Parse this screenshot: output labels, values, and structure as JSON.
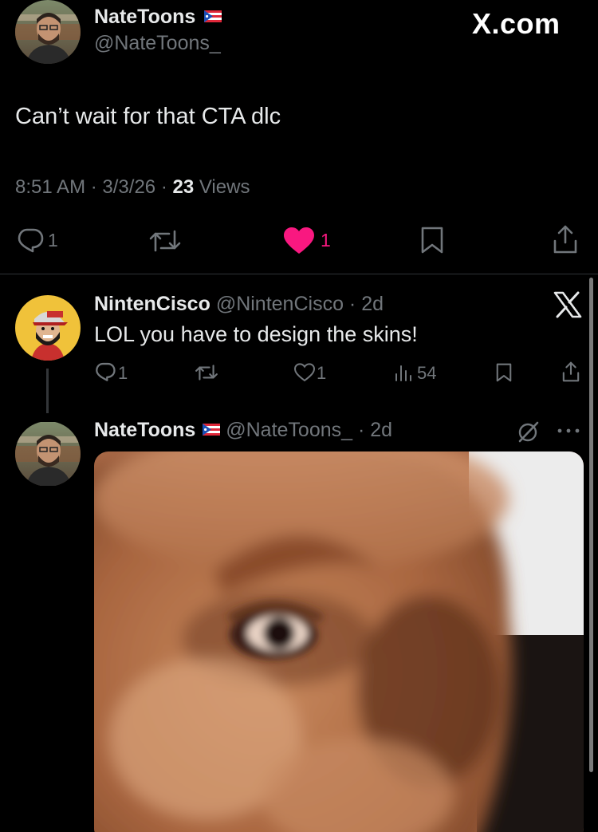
{
  "main_tweet": {
    "author_name": "NateToons",
    "handle": "@NateToons_",
    "watermark": "X.com",
    "text": "Can’t wait for that CTA dlc",
    "time": "8:51 AM",
    "date": "3/3/26",
    "views_count": "23",
    "views_label": "Views",
    "reply_count": "1",
    "like_count": "1",
    "like_color": "#f91880"
  },
  "reply_1": {
    "author_name": "NintenCisco",
    "handle": "@NintenCisco",
    "time": "2d",
    "text": "LOL you have to design the skins!",
    "reply_count": "1",
    "like_count": "1",
    "views_count": "54"
  },
  "reply_2": {
    "author_name": "NateToons",
    "handle": "@NateToons_",
    "time": "2d",
    "media": "close-up face image"
  },
  "separator": "·",
  "icons": [
    "reply-icon",
    "retweet-icon",
    "like-icon",
    "bookmark-icon",
    "share-icon",
    "views-icon",
    "x-logo-icon",
    "grok-icon",
    "more-icon",
    "pr-flag-icon"
  ],
  "colors": {
    "background": "#000000",
    "text": "#e7e9ea",
    "muted": "#71767b",
    "like": "#f91880"
  }
}
